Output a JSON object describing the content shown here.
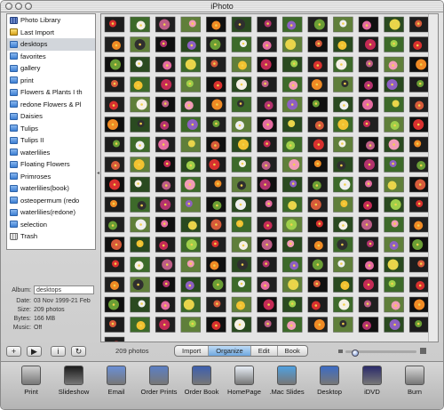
{
  "window": {
    "title": "iPhoto"
  },
  "sidebar": {
    "items": [
      {
        "label": "Photo Library",
        "icon": "library-icon",
        "selected": false
      },
      {
        "label": "Last Import",
        "icon": "import-icon",
        "selected": false
      },
      {
        "label": "desktops",
        "icon": "folder-icon",
        "selected": true
      },
      {
        "label": "favorites",
        "icon": "folder-icon",
        "selected": false
      },
      {
        "label": "gallery",
        "icon": "folder-icon",
        "selected": false
      },
      {
        "label": "print",
        "icon": "folder-icon",
        "selected": false
      },
      {
        "label": "Flowers & Plants I th",
        "icon": "folder-icon",
        "selected": false
      },
      {
        "label": "redone Flowers & Pl",
        "icon": "folder-icon",
        "selected": false
      },
      {
        "label": "Daisies",
        "icon": "folder-icon",
        "selected": false
      },
      {
        "label": "Tulips",
        "icon": "folder-icon",
        "selected": false
      },
      {
        "label": "Tulips II",
        "icon": "folder-icon",
        "selected": false
      },
      {
        "label": "waterlilies",
        "icon": "folder-icon",
        "selected": false
      },
      {
        "label": "Floating Flowers",
        "icon": "folder-icon",
        "selected": false
      },
      {
        "label": "Primroses",
        "icon": "folder-icon",
        "selected": false
      },
      {
        "label": "waterlilies(book)",
        "icon": "folder-icon",
        "selected": false
      },
      {
        "label": "osteopermum (redo",
        "icon": "folder-icon",
        "selected": false
      },
      {
        "label": "waterlilies(redone)",
        "icon": "folder-icon",
        "selected": false
      },
      {
        "label": "selection",
        "icon": "folder-icon",
        "selected": false
      },
      {
        "label": "Trash",
        "icon": "trash-icon",
        "selected": false
      }
    ]
  },
  "info": {
    "album_label": "Album:",
    "album_value": "desktops",
    "date_label": "Date:",
    "date_value": "03 Nov 1999-21 Feb",
    "size_label": "Size:",
    "size_value": "209 photos",
    "bytes_label": "Bytes:",
    "bytes_value": "166 MB",
    "music_label": "Music:",
    "music_value": "Off"
  },
  "sidebar_buttons": {
    "add": "+",
    "play": "▶",
    "info": "i",
    "rotate": "↻"
  },
  "photos": {
    "count": 209,
    "columns": 13,
    "palette": [
      "#d8302f",
      "#f2c230",
      "#e46aa0",
      "#8e5fc2",
      "#f08a24",
      "#f6f0e6",
      "#c42a56",
      "#e8d54a",
      "#6a9e35",
      "#2f2f2f",
      "#bd5c86",
      "#9fcf4a",
      "#d65a3a",
      "#efefef",
      "#b3326e",
      "#f29bb6"
    ]
  },
  "status": {
    "count_text": "209 photos",
    "modes": [
      "Import",
      "Organize",
      "Edit",
      "Book"
    ],
    "active_mode": "Organize",
    "zoom_level": 0.1
  },
  "toolbar": {
    "items": [
      {
        "label": "Print",
        "icon": "printer-icon",
        "color": "#cfcfcf"
      },
      {
        "label": "Slideshow",
        "icon": "slideshow-icon",
        "color": "#1b1b1b"
      },
      {
        "label": "Email",
        "icon": "email-icon",
        "color": "#6a8fd6"
      },
      {
        "label": "Order Prints",
        "icon": "order-prints-icon",
        "color": "#5b7fc4"
      },
      {
        "label": "Order Book",
        "icon": "order-book-icon",
        "color": "#3d5fae"
      },
      {
        "label": "HomePage",
        "icon": "homepage-icon",
        "color": "#e8eef6"
      },
      {
        "label": ".Mac Slides",
        "icon": "mac-slides-icon",
        "color": "#4fa0e0"
      },
      {
        "label": "Desktop",
        "icon": "desktop-icon",
        "color": "#3c6bc4"
      },
      {
        "label": "iDVD",
        "icon": "idvd-icon",
        "color": "#2a2a6a"
      },
      {
        "label": "Burn",
        "icon": "burn-icon",
        "color": "#d8d8d8"
      }
    ]
  }
}
